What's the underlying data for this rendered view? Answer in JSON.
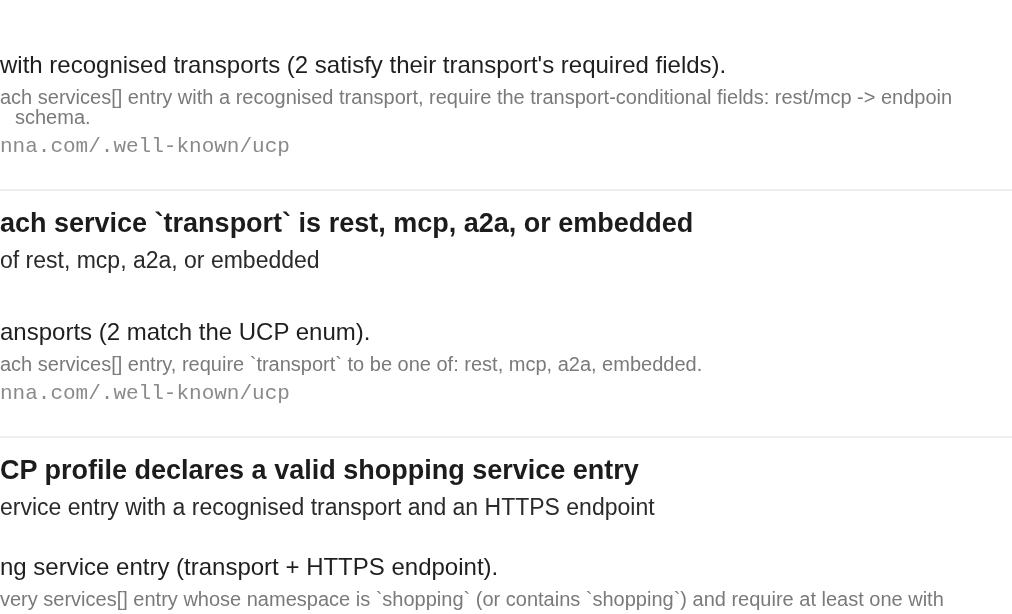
{
  "checks": [
    {
      "result": "with recognised transports (2 satisfy their transport's required fields).",
      "detail": "ach services[] entry with a recognised transport, require the transport-conditional fields: rest/mcp -> endpoin",
      "detail_continued": "schema.",
      "url": "nna.com/.well-known/ucp"
    },
    {
      "title": "ach service `transport` is rest, mcp, a2a, or embedded",
      "subtitle": "of rest, mcp, a2a, or embedded",
      "result": "ansports (2 match the UCP enum).",
      "detail": "ach services[] entry, require `transport` to be one of: rest, mcp, a2a, embedded.",
      "url": "nna.com/.well-known/ucp"
    },
    {
      "title": "CP profile declares a valid shopping service entry",
      "subtitle": "ervice entry with a recognised transport and an HTTPS endpoint",
      "result": "ng service entry (transport + HTTPS endpoint).",
      "detail": "very services[] entry whose namespace is `shopping` (or contains `shopping`) and require at least one with"
    }
  ]
}
